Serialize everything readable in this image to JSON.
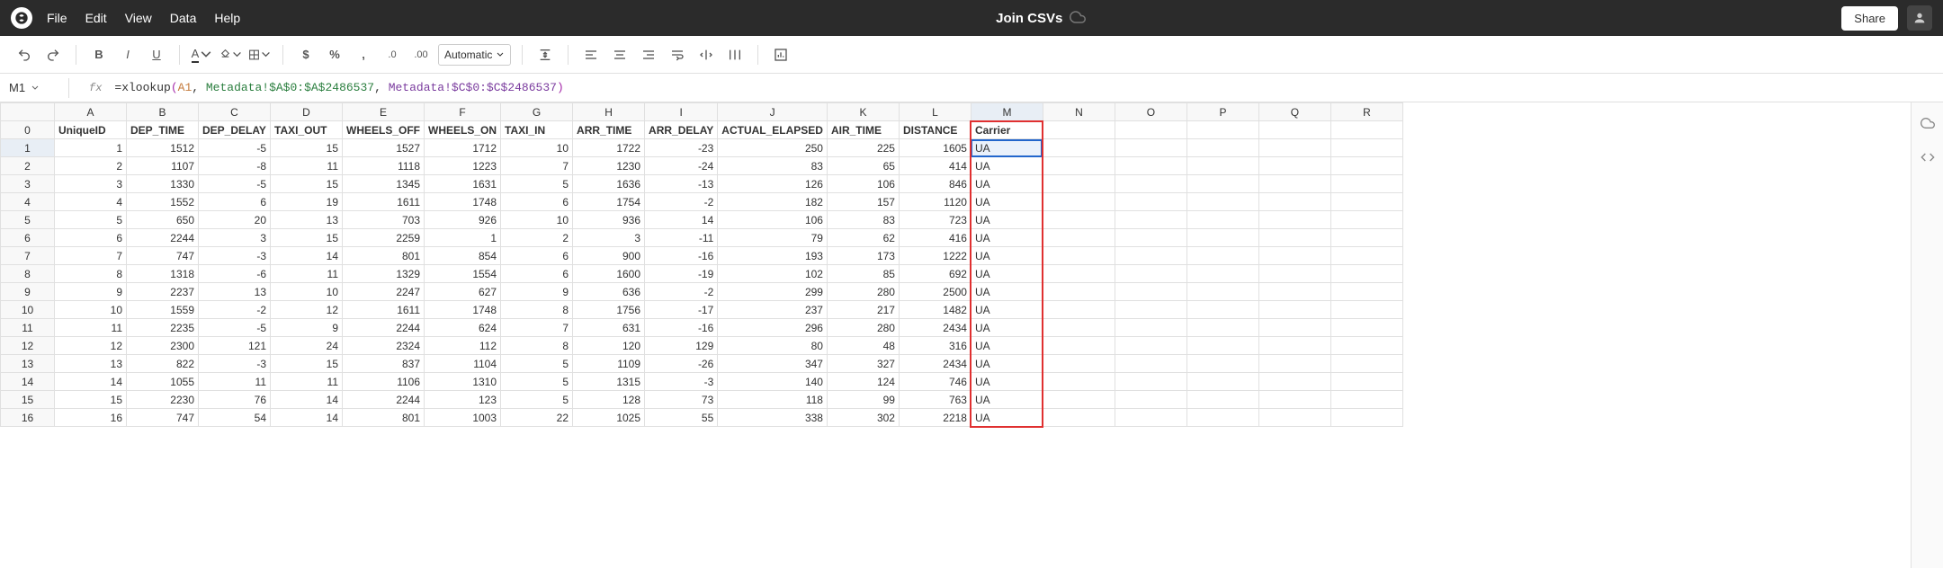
{
  "topbar": {
    "menu": [
      "File",
      "Edit",
      "View",
      "Data",
      "Help"
    ],
    "doc_title": "Join CSVs",
    "share_label": "Share"
  },
  "toolbar": {
    "format_select": "Automatic",
    "font_size": "10"
  },
  "formula_bar": {
    "cell_ref": "M1",
    "fx": "fx",
    "fn": "=xlookup",
    "arg1": "A1",
    "arg2": "Metadata!$A$0:$A$2486537",
    "arg3": "Metadata!$C$0:$C$2486537"
  },
  "grid": {
    "col_letters": [
      "A",
      "B",
      "C",
      "D",
      "E",
      "F",
      "G",
      "H",
      "I",
      "J",
      "K",
      "L",
      "M",
      "N",
      "O",
      "P",
      "Q",
      "R"
    ],
    "header_row": [
      "UniqueID",
      "DEP_TIME",
      "DEP_DELAY",
      "TAXI_OUT",
      "WHEELS_OFF",
      "WHEELS_ON",
      "TAXI_IN",
      "ARR_TIME",
      "ARR_DELAY",
      "ACTUAL_ELAPSED",
      "AIR_TIME",
      "DISTANCE",
      "Carrier",
      "",
      "",
      "",
      "",
      ""
    ],
    "rows": [
      [
        "1",
        "1512",
        "-5",
        "15",
        "1527",
        "1712",
        "10",
        "1722",
        "-23",
        "250",
        "225",
        "1605",
        "UA"
      ],
      [
        "2",
        "1107",
        "-8",
        "11",
        "1118",
        "1223",
        "7",
        "1230",
        "-24",
        "83",
        "65",
        "414",
        "UA"
      ],
      [
        "3",
        "1330",
        "-5",
        "15",
        "1345",
        "1631",
        "5",
        "1636",
        "-13",
        "126",
        "106",
        "846",
        "UA"
      ],
      [
        "4",
        "1552",
        "6",
        "19",
        "1611",
        "1748",
        "6",
        "1754",
        "-2",
        "182",
        "157",
        "1120",
        "UA"
      ],
      [
        "5",
        "650",
        "20",
        "13",
        "703",
        "926",
        "10",
        "936",
        "14",
        "106",
        "83",
        "723",
        "UA"
      ],
      [
        "6",
        "2244",
        "3",
        "15",
        "2259",
        "1",
        "2",
        "3",
        "-11",
        "79",
        "62",
        "416",
        "UA"
      ],
      [
        "7",
        "747",
        "-3",
        "14",
        "801",
        "854",
        "6",
        "900",
        "-16",
        "193",
        "173",
        "1222",
        "UA"
      ],
      [
        "8",
        "1318",
        "-6",
        "11",
        "1329",
        "1554",
        "6",
        "1600",
        "-19",
        "102",
        "85",
        "692",
        "UA"
      ],
      [
        "9",
        "2237",
        "13",
        "10",
        "2247",
        "627",
        "9",
        "636",
        "-2",
        "299",
        "280",
        "2500",
        "UA"
      ],
      [
        "10",
        "1559",
        "-2",
        "12",
        "1611",
        "1748",
        "8",
        "1756",
        "-17",
        "237",
        "217",
        "1482",
        "UA"
      ],
      [
        "11",
        "2235",
        "-5",
        "9",
        "2244",
        "624",
        "7",
        "631",
        "-16",
        "296",
        "280",
        "2434",
        "UA"
      ],
      [
        "12",
        "2300",
        "121",
        "24",
        "2324",
        "112",
        "8",
        "120",
        "129",
        "80",
        "48",
        "316",
        "UA"
      ],
      [
        "13",
        "822",
        "-3",
        "15",
        "837",
        "1104",
        "5",
        "1109",
        "-26",
        "347",
        "327",
        "2434",
        "UA"
      ],
      [
        "14",
        "1055",
        "11",
        "11",
        "1106",
        "1310",
        "5",
        "1315",
        "-3",
        "140",
        "124",
        "746",
        "UA"
      ],
      [
        "15",
        "2230",
        "76",
        "14",
        "2244",
        "123",
        "5",
        "128",
        "73",
        "118",
        "99",
        "763",
        "UA"
      ],
      [
        "16",
        "747",
        "54",
        "14",
        "801",
        "1003",
        "22",
        "1025",
        "55",
        "338",
        "302",
        "2218",
        "UA"
      ]
    ]
  }
}
